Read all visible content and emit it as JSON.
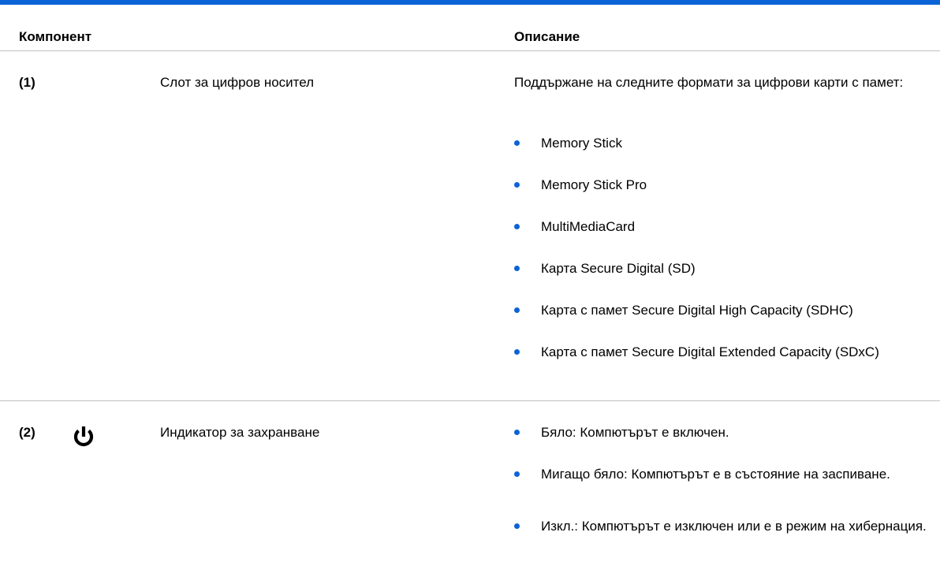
{
  "header": {
    "component": "Компонент",
    "description": "Описание"
  },
  "rows": [
    {
      "number": "(1)",
      "name": "Слот за цифров носител",
      "description": "Поддържане на следните формати за цифрови карти с памет:",
      "bullets": [
        "Memory Stick",
        "Memory Stick Pro",
        "MultiMediaCard",
        "Карта Secure Digital (SD)",
        "Карта с памет Secure Digital High Capacity (SDHC)",
        "Карта с памет Secure Digital Extended Capacity (SDxC)"
      ]
    },
    {
      "number": "(2)",
      "icon": "power-icon",
      "name": "Индикатор за захранване",
      "bullets": [
        "Бяло: Компютърът е включен.",
        "Мигащо бяло: Компютърът е в състояние на заспиване.",
        "Изкл.: Компютърът е изключен или е в режим на хибернация."
      ]
    }
  ],
  "colors": {
    "accent": "#0b63d6",
    "rule": "#bfbfbf"
  }
}
